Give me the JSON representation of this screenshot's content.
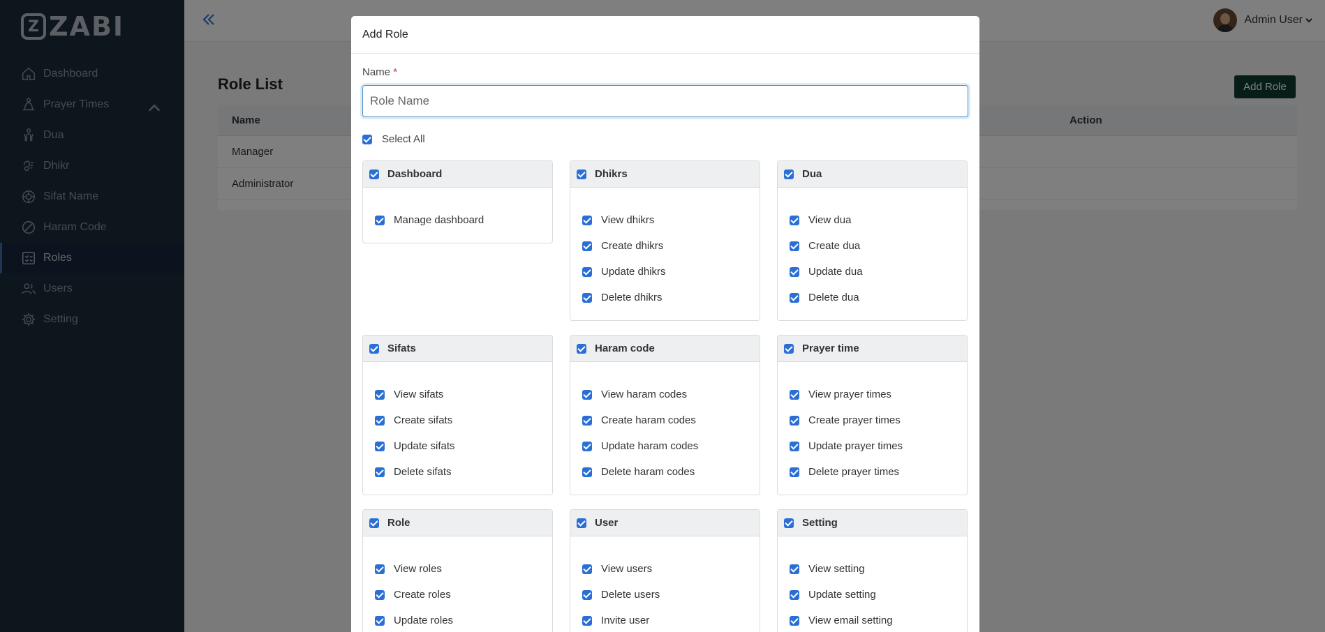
{
  "app": {
    "logo_mark": "Z",
    "logo_text": "ZABI"
  },
  "sidebar": {
    "items": [
      {
        "label": "Dashboard",
        "icon": "home-icon"
      },
      {
        "label": "Prayer Times",
        "icon": "prayer-icon"
      },
      {
        "label": "Dua",
        "icon": "dua-icon"
      },
      {
        "label": "Dhikr",
        "icon": "dhikr-icon"
      },
      {
        "label": "Sifat Name",
        "icon": "sifat-icon"
      },
      {
        "label": "Haram Code",
        "icon": "prohibited-icon"
      },
      {
        "label": "Roles",
        "icon": "roles-icon",
        "active": true
      },
      {
        "label": "Users",
        "icon": "users-icon"
      },
      {
        "label": "Setting",
        "icon": "gear-icon"
      }
    ]
  },
  "header": {
    "user_name": "Admin User"
  },
  "page": {
    "title": "Role List",
    "add_button": "Add Role",
    "table": {
      "columns": [
        "Name",
        "Action"
      ],
      "rows": [
        "Manager",
        "Administrator"
      ]
    }
  },
  "modal": {
    "title": "Add Role",
    "name_label": "Name",
    "required_mark": "*",
    "name_placeholder": "Role Name",
    "select_all": "Select All",
    "groups": [
      {
        "title": "Dashboard",
        "permissions": [
          "Manage dashboard"
        ]
      },
      {
        "title": "Dhikrs",
        "permissions": [
          "View dhikrs",
          "Create dhikrs",
          "Update dhikrs",
          "Delete dhikrs"
        ]
      },
      {
        "title": "Dua",
        "permissions": [
          "View dua",
          "Create dua",
          "Update dua",
          "Delete dua"
        ]
      },
      {
        "title": "Sifats",
        "permissions": [
          "View sifats",
          "Create sifats",
          "Update sifats",
          "Delete sifats"
        ]
      },
      {
        "title": "Haram code",
        "permissions": [
          "View haram codes",
          "Create haram codes",
          "Update haram codes",
          "Delete haram codes"
        ]
      },
      {
        "title": "Prayer time",
        "permissions": [
          "View prayer times",
          "Create prayer times",
          "Update prayer times",
          "Delete prayer times"
        ]
      },
      {
        "title": "Role",
        "permissions": [
          "View roles",
          "Create roles",
          "Update roles"
        ]
      },
      {
        "title": "User",
        "permissions": [
          "View users",
          "Delete users",
          "Invite user"
        ]
      },
      {
        "title": "Setting",
        "permissions": [
          "View setting",
          "Update setting",
          "View email setting"
        ]
      }
    ]
  },
  "colors": {
    "sidebar_bg": "#1b2a3b",
    "accent": "#2a6fd6",
    "primary_button": "#0f3d30"
  }
}
